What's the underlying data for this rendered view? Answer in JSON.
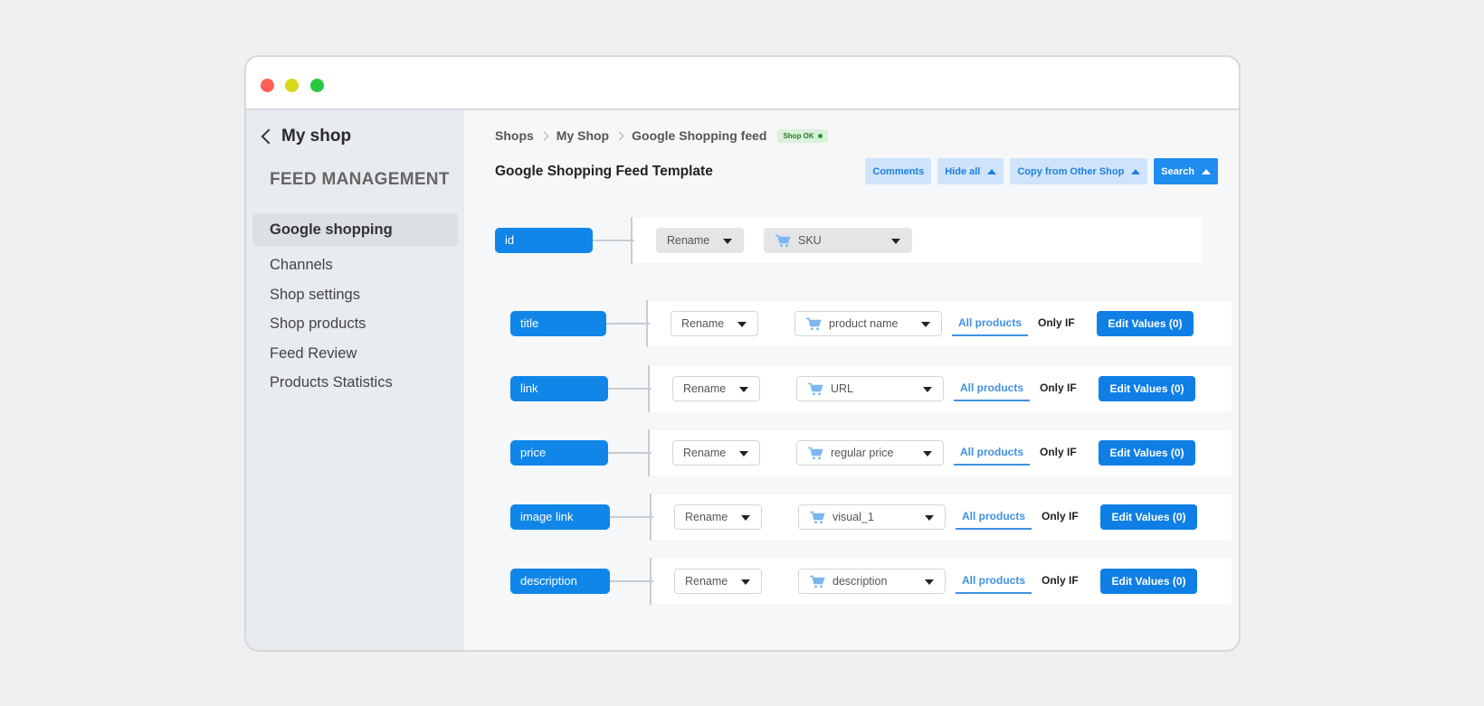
{
  "window": {
    "back_label": "My shop",
    "section_heading": "FEED MANAGEMENT"
  },
  "sidebar": {
    "items": [
      {
        "label": "Google shopping",
        "active": true
      },
      {
        "label": "Channels"
      },
      {
        "label": "Shop settings"
      },
      {
        "label": "Shop products"
      },
      {
        "label": "Feed Review"
      },
      {
        "label": "Products Statistics"
      }
    ]
  },
  "breadcrumb": {
    "items": [
      "Shops",
      "My Shop",
      "Google Shopping feed"
    ],
    "badge": "Shop OK"
  },
  "main": {
    "title": "Google Shopping Feed Template",
    "toolbar": {
      "comments": "Comments",
      "hide_all": "Hide all",
      "copy": "Copy from Other Shop",
      "search": "Search"
    }
  },
  "id_row": {
    "field": "id",
    "rename": "Rename",
    "source": "SKU"
  },
  "rows": [
    {
      "field": "title",
      "rename": "Rename",
      "source": "product name",
      "tab_all": "All products",
      "tab_only": "Only IF",
      "edit": "Edit Values (0)"
    },
    {
      "field": "link",
      "rename": "Rename",
      "source": "URL",
      "tab_all": "All products",
      "tab_only": "Only IF",
      "edit": "Edit Values (0)"
    },
    {
      "field": "price",
      "rename": "Rename",
      "source": "regular price",
      "tab_all": "All products",
      "tab_only": "Only IF",
      "edit": "Edit Values (0)"
    },
    {
      "field": "image link",
      "rename": "Rename",
      "source": "visual_1",
      "tab_all": "All products",
      "tab_only": "Only IF",
      "edit": "Edit Values (0)"
    },
    {
      "field": "description",
      "rename": "Rename",
      "source": "description",
      "tab_all": "All products",
      "tab_only": "Only IF",
      "edit": "Edit Values (0)"
    }
  ],
  "colors": {
    "accent": "#1186e9",
    "accent_light": "#cfe4fb",
    "sidebar_bg": "#e8ebef",
    "badge_bg": "#d9f2d9"
  },
  "icons": [
    "chevron-left-icon",
    "chevron-right-icon",
    "cart-icon",
    "caret-down-icon",
    "caret-up-icon",
    "status-dot-icon"
  ]
}
